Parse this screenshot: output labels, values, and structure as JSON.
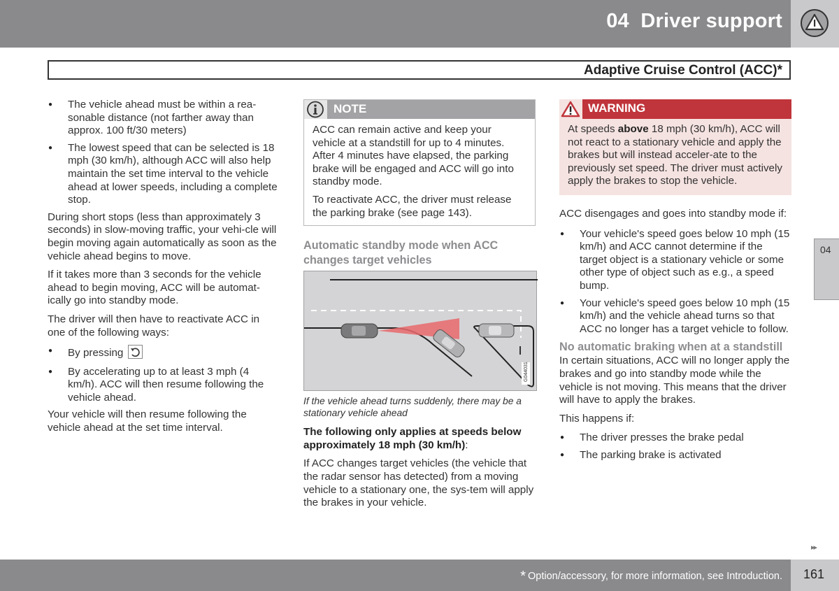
{
  "header": {
    "chapter_number": "04",
    "chapter_title": "Driver support",
    "chapter_icon": "warning-triangle-circle-icon",
    "section_title": "Adaptive Cruise Control (ACC)*"
  },
  "column1": {
    "bullets_top": [
      "The vehicle ahead must be within a rea-sonable distance (not farther away than approx. 100 ft/30 meters)",
      "The lowest speed that can be selected is 18 mph (30 km/h), although ACC will also help maintain the set time interval to the vehicle ahead at lower speeds, including a complete stop."
    ],
    "paragraphs": [
      "During short stops (less than approximately 3 seconds) in slow-moving traffic, your vehi-cle will begin moving again automatically as soon as the vehicle ahead begins to move.",
      "If it takes more than 3 seconds for the vehicle ahead to begin moving, ACC will be automat-ically go into standby mode.",
      "The driver will then have to reactivate ACC in one of the following ways:"
    ],
    "reactivate_bullets": [
      {
        "text": "By pressing",
        "icon": "resume-arrow-icon"
      },
      {
        "text": "By accelerating up to at least 3 mph (4 km/h). ACC will then resume following the vehicle ahead."
      }
    ],
    "closing": "Your vehicle will then resume following the vehicle ahead at the set time interval."
  },
  "column2": {
    "note": {
      "label": "NOTE",
      "icon": "info-icon",
      "paragraphs": [
        "ACC can remain active and keep your vehicle at a standstill for up to 4 minutes. After 4 minutes have elapsed, the parking brake will be engaged and ACC will go into standby mode.",
        "To reactivate ACC, the driver must release the parking brake (see page 143)."
      ]
    },
    "subheading": "Automatic standby mode when ACC changes target vehicles",
    "illustration_code": "G044031",
    "caption": "If the vehicle ahead turns suddenly, there may be a stationary vehicle ahead",
    "bold_lead": "The following only applies at speeds below approximately 18 mph (30 km/h)",
    "bold_lead_suffix": ":",
    "body": "If ACC changes target vehicles (the vehicle that the radar sensor has detected) from a moving vehicle to a stationary one, the sys-tem will apply the brakes in your vehicle."
  },
  "column3": {
    "warning": {
      "label": "WARNING",
      "icon": "warning-triangle-icon",
      "text_before": "At speeds ",
      "text_bold": "above",
      "text_after": " 18 mph (30 km/h), ACC will not react to a stationary vehicle and apply the brakes but will instead acceler-ate to the previously set speed. The driver must actively apply the brakes to stop the vehicle."
    },
    "intro": "ACC disengages and goes into standby mode if:",
    "standby_bullets": [
      "Your vehicle's speed goes below 10 mph (15 km/h) and ACC cannot determine if the target object is a stationary vehicle or some other type of object such as e.g., a speed bump.",
      "Your vehicle's speed goes below 10 mph (15 km/h) and the vehicle ahead turns so that ACC no longer has a target vehicle to follow."
    ],
    "subheading": "No automatic braking when at a standstill",
    "body": "In certain situations, ACC will no longer apply the brakes and go into standby mode while the vehicle is not moving. This means that the driver will have to apply the brakes.",
    "happens_if": "This happens if:",
    "happens_bullets": [
      "The driver presses the brake pedal",
      "The parking brake is activated"
    ]
  },
  "side_tab": "04",
  "continue_marker": "▸▸",
  "footer": {
    "footnote_star": "*",
    "footnote": "Option/accessory, for more information, see Introduction.",
    "page_number": "161"
  },
  "colors": {
    "header_gray": "#8a8a8d",
    "light_gray": "#c9c9cb",
    "warning_red": "#c0343b",
    "warning_bg": "#f5e3e1",
    "subhead_gray": "#8d8d90",
    "radar_red": "#e8686c"
  }
}
